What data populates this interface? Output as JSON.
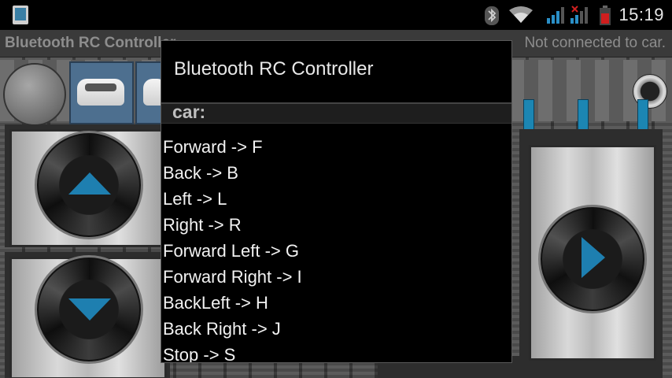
{
  "statusbar": {
    "time": "15:19",
    "left_icon": "phone-screenshot-icon",
    "icons": [
      "bluetooth-icon",
      "wifi-icon",
      "signal-icon",
      "signal-x-icon",
      "battery-low-icon"
    ]
  },
  "app": {
    "title": "Bluetooth RC Controller",
    "connection_status": "Not connected to car.",
    "colors": {
      "accent": "#1c86b3",
      "dialog_bg": "#000000"
    }
  },
  "dialog": {
    "title": "Bluetooth RC Controller",
    "header": "car:",
    "items": [
      "Forward -> F",
      "Back -> B",
      "Left -> L",
      "Right -> R",
      "Forward Left -> G",
      "Forward Right -> I",
      "BackLeft -> H",
      "Back Right -> J",
      "Stop -> S"
    ]
  },
  "controls": {
    "forward_icon": "arrow-up-icon",
    "back_icon": "arrow-down-icon",
    "right_icon": "arrow-right-icon"
  }
}
